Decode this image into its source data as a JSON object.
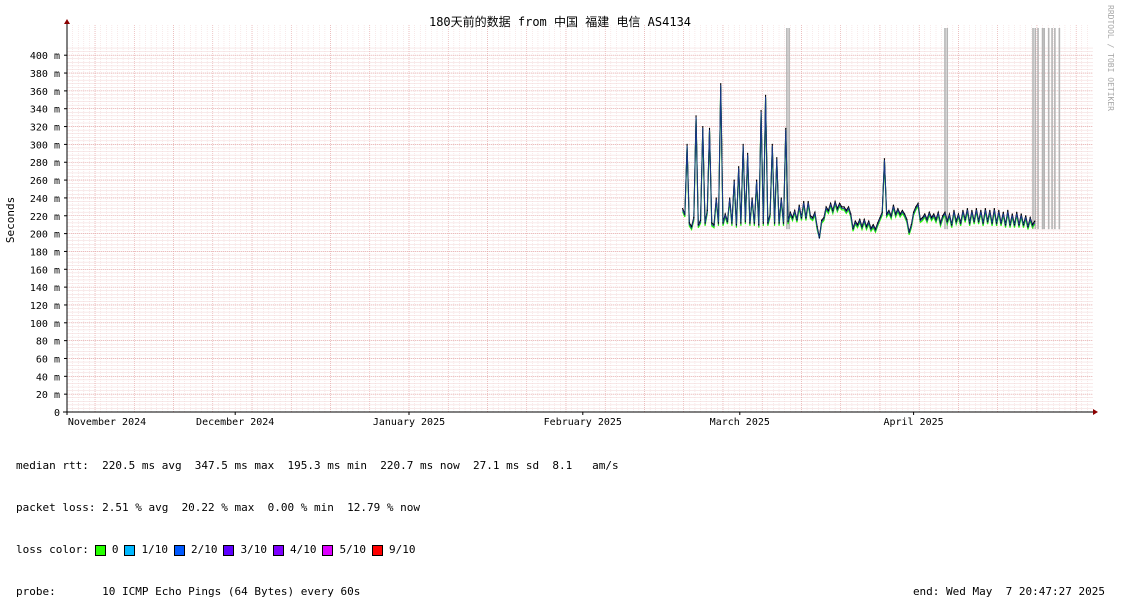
{
  "chart_data": {
    "type": "line",
    "title": "180天前的数据 from 中国 福建 电信 AS4134",
    "ylabel": "Seconds",
    "watermark": "RRDTOOL / TOBI OETIKER",
    "ylim": [
      0,
      410
    ],
    "yticks": [
      {
        "value": 0,
        "label": "0"
      },
      {
        "value": 20,
        "label": "20 m"
      },
      {
        "value": 40,
        "label": "40 m"
      },
      {
        "value": 60,
        "label": "60 m"
      },
      {
        "value": 80,
        "label": "80 m"
      },
      {
        "value": 100,
        "label": "100 m"
      },
      {
        "value": 120,
        "label": "120 m"
      },
      {
        "value": 140,
        "label": "140 m"
      },
      {
        "value": 160,
        "label": "160 m"
      },
      {
        "value": 180,
        "label": "180 m"
      },
      {
        "value": 200,
        "label": "200 m"
      },
      {
        "value": 220,
        "label": "220 m"
      },
      {
        "value": 240,
        "label": "240 m"
      },
      {
        "value": 260,
        "label": "260 m"
      },
      {
        "value": 280,
        "label": "280 m"
      },
      {
        "value": 300,
        "label": "300 m"
      },
      {
        "value": 320,
        "label": "320 m"
      },
      {
        "value": 340,
        "label": "340 m"
      },
      {
        "value": 360,
        "label": "360 m"
      },
      {
        "value": 380,
        "label": "380 m"
      },
      {
        "value": 400,
        "label": "400 m"
      }
    ],
    "xlim": [
      0,
      183
    ],
    "xticks": [
      {
        "value": 0,
        "label": "November 2024"
      },
      {
        "value": 30,
        "label": "December 2024"
      },
      {
        "value": 61,
        "label": "January 2025"
      },
      {
        "value": 92,
        "label": "February 2025"
      },
      {
        "value": 120,
        "label": "March 2025"
      },
      {
        "value": 151,
        "label": "April 2025"
      }
    ],
    "grid": true,
    "series": [
      {
        "name": "median rtt",
        "color": "#1a3a8c",
        "points": [
          [
            109.8,
            228
          ],
          [
            110.2,
            222
          ],
          [
            110.6,
            300
          ],
          [
            111.0,
            212
          ],
          [
            111.4,
            208
          ],
          [
            111.8,
            218
          ],
          [
            112.2,
            332
          ],
          [
            112.6,
            210
          ],
          [
            113.0,
            215
          ],
          [
            113.4,
            320
          ],
          [
            113.8,
            212
          ],
          [
            114.2,
            226
          ],
          [
            114.6,
            318
          ],
          [
            115.0,
            212
          ],
          [
            115.4,
            210
          ],
          [
            115.8,
            240
          ],
          [
            116.2,
            212
          ],
          [
            116.6,
            368
          ],
          [
            117.0,
            212
          ],
          [
            117.4,
            222
          ],
          [
            117.8,
            214
          ],
          [
            118.2,
            240
          ],
          [
            118.6,
            212
          ],
          [
            119.0,
            260
          ],
          [
            119.4,
            210
          ],
          [
            119.8,
            275
          ],
          [
            120.2,
            212
          ],
          [
            120.6,
            300
          ],
          [
            121.0,
            214
          ],
          [
            121.4,
            290
          ],
          [
            121.8,
            212
          ],
          [
            122.2,
            240
          ],
          [
            122.6,
            212
          ],
          [
            123.0,
            260
          ],
          [
            123.4,
            210
          ],
          [
            123.8,
            338
          ],
          [
            124.2,
            212
          ],
          [
            124.6,
            355
          ],
          [
            125.0,
            212
          ],
          [
            125.4,
            222
          ],
          [
            125.8,
            300
          ],
          [
            126.2,
            212
          ],
          [
            126.6,
            285
          ],
          [
            127.0,
            212
          ],
          [
            127.4,
            240
          ],
          [
            127.8,
            212
          ],
          [
            128.2,
            318
          ],
          [
            128.6,
            214
          ],
          [
            129.0,
            224
          ],
          [
            129.4,
            218
          ],
          [
            129.8,
            226
          ],
          [
            130.2,
            216
          ],
          [
            130.6,
            232
          ],
          [
            131.0,
            218
          ],
          [
            131.4,
            236
          ],
          [
            131.8,
            218
          ],
          [
            132.2,
            236
          ],
          [
            132.6,
            220
          ],
          [
            133.0,
            218
          ],
          [
            133.4,
            224
          ],
          [
            133.8,
            208
          ],
          [
            134.2,
            196
          ],
          [
            134.6,
            215
          ],
          [
            135.0,
            218
          ],
          [
            135.4,
            230
          ],
          [
            135.8,
            226
          ],
          [
            136.2,
            234
          ],
          [
            136.6,
            226
          ],
          [
            137.0,
            236
          ],
          [
            137.4,
            228
          ],
          [
            137.8,
            234
          ],
          [
            138.2,
            230
          ],
          [
            138.6,
            230
          ],
          [
            139.0,
            226
          ],
          [
            139.4,
            230
          ],
          [
            139.8,
            222
          ],
          [
            140.2,
            206
          ],
          [
            140.6,
            214
          ],
          [
            141.0,
            210
          ],
          [
            141.4,
            216
          ],
          [
            141.8,
            208
          ],
          [
            142.2,
            216
          ],
          [
            142.6,
            208
          ],
          [
            143.0,
            214
          ],
          [
            143.4,
            206
          ],
          [
            143.8,
            210
          ],
          [
            144.2,
            205
          ],
          [
            144.6,
            212
          ],
          [
            145.0,
            218
          ],
          [
            145.4,
            224
          ],
          [
            145.8,
            284
          ],
          [
            146.2,
            222
          ],
          [
            146.6,
            226
          ],
          [
            147.0,
            220
          ],
          [
            147.4,
            232
          ],
          [
            147.8,
            222
          ],
          [
            148.2,
            228
          ],
          [
            148.6,
            222
          ],
          [
            149.0,
            226
          ],
          [
            149.4,
            222
          ],
          [
            149.8,
            216
          ],
          [
            150.2,
            202
          ],
          [
            150.6,
            210
          ],
          [
            151.0,
            224
          ],
          [
            151.4,
            230
          ],
          [
            151.8,
            234
          ],
          [
            152.2,
            216
          ],
          [
            152.6,
            218
          ],
          [
            153.0,
            222
          ],
          [
            153.4,
            216
          ],
          [
            153.8,
            224
          ],
          [
            154.2,
            218
          ],
          [
            154.6,
            222
          ],
          [
            155.0,
            216
          ],
          [
            155.4,
            224
          ],
          [
            155.8,
            212
          ],
          [
            156.2,
            220
          ],
          [
            156.6,
            224
          ],
          [
            157.0,
            214
          ],
          [
            157.4,
            222
          ],
          [
            157.8,
            210
          ],
          [
            158.2,
            226
          ],
          [
            158.6,
            214
          ],
          [
            159.0,
            222
          ],
          [
            159.4,
            212
          ],
          [
            159.8,
            226
          ],
          [
            160.2,
            216
          ],
          [
            160.6,
            228
          ],
          [
            161.0,
            212
          ],
          [
            161.4,
            226
          ],
          [
            161.8,
            214
          ],
          [
            162.2,
            228
          ],
          [
            162.6,
            214
          ],
          [
            163.0,
            226
          ],
          [
            163.4,
            212
          ],
          [
            163.8,
            228
          ],
          [
            164.2,
            214
          ],
          [
            164.6,
            226
          ],
          [
            165.0,
            212
          ],
          [
            165.4,
            228
          ],
          [
            165.8,
            212
          ],
          [
            166.2,
            226
          ],
          [
            166.6,
            212
          ],
          [
            167.0,
            224
          ],
          [
            167.4,
            210
          ],
          [
            167.8,
            226
          ],
          [
            168.2,
            210
          ],
          [
            168.6,
            222
          ],
          [
            169.0,
            210
          ],
          [
            169.4,
            224
          ],
          [
            169.8,
            210
          ],
          [
            170.2,
            222
          ],
          [
            170.6,
            210
          ],
          [
            171.0,
            220
          ],
          [
            171.4,
            208
          ],
          [
            171.8,
            218
          ],
          [
            172.2,
            210
          ],
          [
            172.6,
            214
          ]
        ]
      }
    ],
    "loss_spikes_x": [
      128.4,
      128.8,
      156.6,
      157.0,
      172.3,
      172.7,
      173.2,
      174.0,
      174.3,
      175.1,
      175.7,
      176.2,
      177.0
    ],
    "loss_colors": {
      "0": "#26ff00",
      "1/10": "#00b8ff",
      "2/10": "#0059ff",
      "3/10": "#5e00ff",
      "4/10": "#7e00ff",
      "5/10": "#dd00ff",
      "9/10": "#ff0000"
    }
  },
  "stats": {
    "median_rtt": "median rtt:  220.5 ms avg  347.5 ms max  195.3 ms min  220.7 ms now  27.1 ms sd  8.1   am/s",
    "packet_loss": "packet loss: 2.51 % avg  20.22 % max  0.00 % min  12.79 % now",
    "loss_color_label": "loss color:",
    "loss_items": [
      {
        "label": "0",
        "color": "#26ff00"
      },
      {
        "label": "1/10",
        "color": "#00b8ff"
      },
      {
        "label": "2/10",
        "color": "#0059ff"
      },
      {
        "label": "3/10",
        "color": "#5e00ff"
      },
      {
        "label": "4/10",
        "color": "#7e00ff"
      },
      {
        "label": "5/10",
        "color": "#dd00ff"
      },
      {
        "label": "9/10",
        "color": "#ff0000"
      }
    ],
    "probe": "probe:       10 ICMP Echo Pings (64 Bytes) every 60s",
    "end": "end: Wed May  7 20:47:27 2025"
  }
}
